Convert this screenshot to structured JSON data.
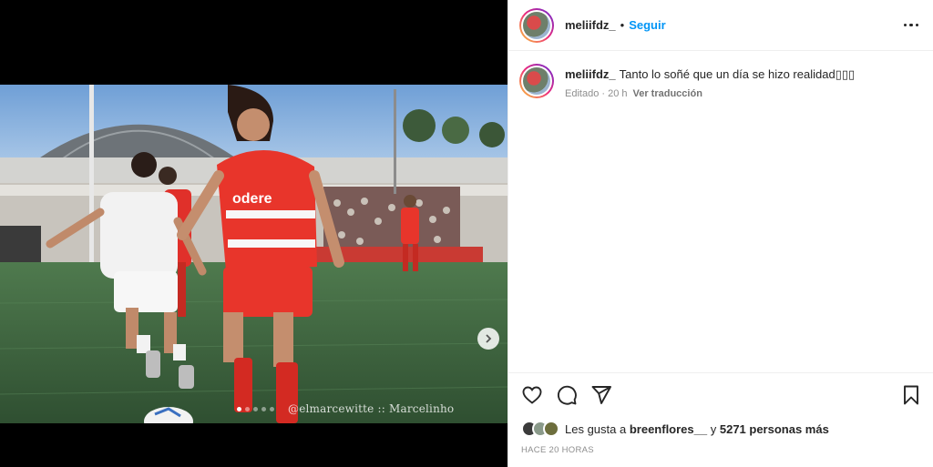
{
  "post": {
    "username": "meliifdz_",
    "separator": "•",
    "follow_label": "Seguir",
    "more_icon": "more-horizontal-icon"
  },
  "caption": {
    "username": "meliifdz_",
    "text": "Tanto lo soñé que un día se hizo realidad▯▯▯",
    "edited": "Editado · 20 h",
    "translate_label": "Ver traducción"
  },
  "media": {
    "watermark": "@elmarcewitte :: Marcelinho",
    "carousel_dots": 5,
    "active_dot": 0,
    "next_icon": "chevron-right-icon",
    "jersey_text": "odere"
  },
  "actions": {
    "like_icon": "heart-icon",
    "comment_icon": "comment-icon",
    "share_icon": "paper-plane-icon",
    "save_icon": "bookmark-icon"
  },
  "likes": {
    "prefix": "Les gusta a",
    "user": "breenflores__",
    "middle": "y",
    "others": "5271 personas más"
  },
  "timestamp": "HACE 20 HORAS",
  "colors": {
    "accent": "#0095f6",
    "text": "#262626",
    "muted": "#8e8e8e",
    "jersey_red": "#e8352b"
  }
}
